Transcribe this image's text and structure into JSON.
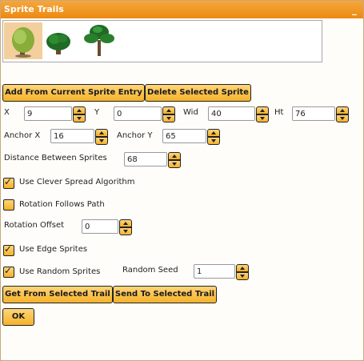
{
  "window": {
    "title": "Sprite Trails",
    "minimize": "_"
  },
  "sprites": [
    {
      "icon": "tree-sprite-icon"
    },
    {
      "icon": "bush-sprite-icon"
    },
    {
      "icon": "palm-tree-sprite-icon"
    }
  ],
  "buttons": {
    "add_from_current": "Add From Current Sprite Entry",
    "delete_selected": "Delete Selected Sprite",
    "get_from_trail": "Get From Selected Trail",
    "send_to_trail": "Send To Selected Trail",
    "ok": "OK"
  },
  "fields": {
    "x": {
      "label": "X",
      "value": "9"
    },
    "y": {
      "label": "Y",
      "value": "0"
    },
    "wid": {
      "label": "Wid",
      "value": "40"
    },
    "ht": {
      "label": "Ht",
      "value": "76"
    },
    "anchor_x": {
      "label": "Anchor X",
      "value": "16"
    },
    "anchor_y": {
      "label": "Anchor Y",
      "value": "65"
    },
    "distance": {
      "label": "Distance Between Sprites",
      "value": "68"
    },
    "rotation_offset": {
      "label": "Rotation Offset",
      "value": "0"
    },
    "random_seed": {
      "label": "Random Seed",
      "value": "1"
    }
  },
  "checkboxes": {
    "clever_spread": {
      "label": "Use Clever Spread Algorithm",
      "checked": true
    },
    "rotation_follows": {
      "label": "Rotation Follows Path",
      "checked": false
    },
    "edge_sprites": {
      "label": "Use Edge Sprites",
      "checked": true
    },
    "random_sprites": {
      "label": "Use Random Sprites",
      "checked": true
    }
  },
  "colors": {
    "accent": "#ec8a12",
    "button": "#f5b229",
    "selected": "#f4cf9e"
  }
}
